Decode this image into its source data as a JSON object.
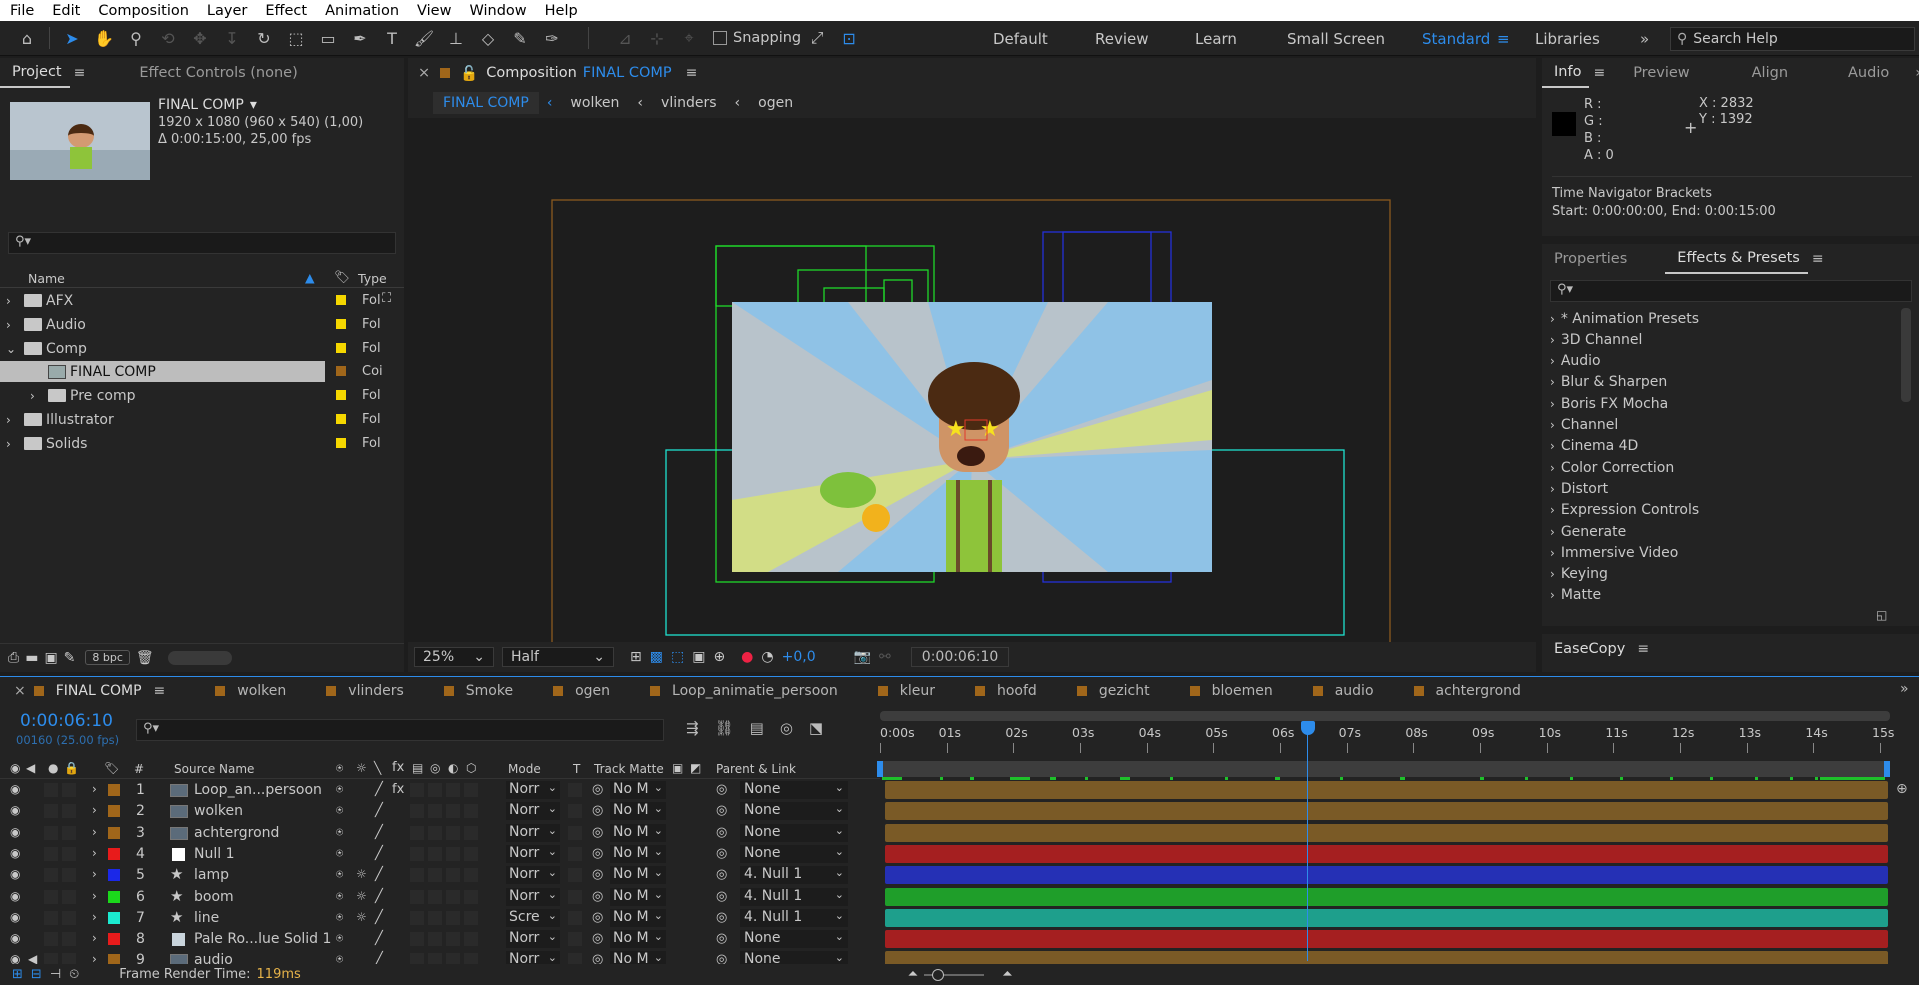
{
  "menu": [
    "File",
    "Edit",
    "Composition",
    "Layer",
    "Effect",
    "Animation",
    "View",
    "Window",
    "Help"
  ],
  "toolbar": {
    "snapping": "Snapping"
  },
  "workspaces": [
    "Default",
    "Review",
    "Learn",
    "Small Screen",
    "Standard",
    "Libraries"
  ],
  "active_workspace": "Standard",
  "search": {
    "placeholder": "Search Help"
  },
  "project": {
    "tabs": [
      "Project",
      "Effect Controls (none)"
    ],
    "comp_name": "FINAL COMP",
    "comp_info1": "1920 x 1080  (960 x 540) (1,00)",
    "comp_info2": "Δ 0:00:15:00, 25,00 fps",
    "columns": {
      "name": "Name",
      "type": "Type"
    },
    "items": [
      {
        "name": "AFX",
        "type": "Fol",
        "color": "#f5d700"
      },
      {
        "name": "Audio",
        "type": "Fol",
        "color": "#f5d700"
      },
      {
        "name": "Comp",
        "type": "Fol",
        "color": "#f5d700"
      },
      {
        "name": "FINAL COMP",
        "type": "Coi",
        "color": "#a0661a"
      },
      {
        "name": "Pre comp",
        "type": "Fol",
        "color": "#f5d700"
      },
      {
        "name": "Illustrator",
        "type": "Fol",
        "color": "#f5d700"
      },
      {
        "name": "Solids",
        "type": "Fol",
        "color": "#f5d700"
      }
    ],
    "bpc": "8 bpc"
  },
  "comp": {
    "tab_prefix": "Composition",
    "tab_name": "FINAL COMP",
    "breadcrumbs": [
      "FINAL COMP",
      "wolken",
      "vlinders",
      "ogen"
    ],
    "zoom": "25%",
    "resolution": "Half",
    "exposure": "+0,0",
    "timecode": "0:00:06:10"
  },
  "info": {
    "tabs": [
      "Info",
      "Preview",
      "Align",
      "Audio"
    ],
    "r": "R :",
    "g": "G :",
    "b": "B :",
    "a": "A :  0",
    "x": "X : 2832",
    "y": "Y : 1392",
    "line1": "Time Navigator Brackets",
    "line2": "Start: 0:00:00:00, End: 0:00:15:00"
  },
  "effects": {
    "tabs": [
      "Properties",
      "Effects & Presets"
    ],
    "items": [
      "* Animation Presets",
      "3D Channel",
      "Audio",
      "Blur & Sharpen",
      "Boris FX Mocha",
      "Channel",
      "Cinema 4D",
      "Color Correction",
      "Distort",
      "Expression Controls",
      "Generate",
      "Immersive Video",
      "Keying",
      "Matte"
    ]
  },
  "easecopy": {
    "title": "EaseCopy"
  },
  "timeline": {
    "tabs": [
      {
        "name": "FINAL COMP",
        "color": "#a0661a"
      },
      {
        "name": "wolken",
        "color": "#a0661a"
      },
      {
        "name": "vlinders",
        "color": "#a0661a"
      },
      {
        "name": "Smoke",
        "color": "#a0661a"
      },
      {
        "name": "ogen",
        "color": "#a0661a"
      },
      {
        "name": "Loop_animatie_persoon",
        "color": "#a0661a"
      },
      {
        "name": "kleur",
        "color": "#a0661a"
      },
      {
        "name": "hoofd",
        "color": "#a0661a"
      },
      {
        "name": "gezicht",
        "color": "#a0661a"
      },
      {
        "name": "bloemen",
        "color": "#a0661a"
      },
      {
        "name": "audio",
        "color": "#a0661a"
      },
      {
        "name": "achtergrond",
        "color": "#a0661a"
      }
    ],
    "timecode": "0:00:06:10",
    "frames": "00160 (25.00 fps)",
    "headers": {
      "num": "#",
      "source": "Source Name",
      "mode": "Mode",
      "t": "T",
      "matte": "Track Matte",
      "parent": "Parent & Link"
    },
    "ruler": [
      "0:00s",
      "01s",
      "02s",
      "03s",
      "04s",
      "05s",
      "06s",
      "07s",
      "08s",
      "09s",
      "10s",
      "11s",
      "12s",
      "13s",
      "14s",
      "15s"
    ],
    "layers": [
      {
        "num": "1",
        "name": "Loop_an...persoon",
        "mode": "Norr",
        "matte": "No M",
        "parent": "None",
        "label": "#a0661a",
        "icon": "comp",
        "bar": "#7a5a26"
      },
      {
        "num": "2",
        "name": "wolken",
        "mode": "Norr",
        "matte": "No M",
        "parent": "None",
        "label": "#a0661a",
        "icon": "comp",
        "bar": "#7a5a26"
      },
      {
        "num": "3",
        "name": "achtergrond",
        "mode": "Norr",
        "matte": "No M",
        "parent": "None",
        "label": "#a0661a",
        "icon": "comp",
        "bar": "#7a5a26"
      },
      {
        "num": "4",
        "name": "Null 1",
        "mode": "Norr",
        "matte": "No M",
        "parent": "None",
        "label": "#e81b1b",
        "icon": "null",
        "bar": "#a51f20"
      },
      {
        "num": "5",
        "name": "lamp",
        "mode": "Norr",
        "matte": "No M",
        "parent": "4. Null 1",
        "label": "#1b28e8",
        "icon": "star",
        "bar": "#2530b5"
      },
      {
        "num": "6",
        "name": "boom",
        "mode": "Norr",
        "matte": "No M",
        "parent": "4. Null 1",
        "label": "#1bd81b",
        "icon": "star",
        "bar": "#1f9e2a"
      },
      {
        "num": "7",
        "name": "line",
        "mode": "Scre",
        "matte": "No M",
        "parent": "4. Null 1",
        "label": "#1bead0",
        "icon": "star",
        "bar": "#1e9f8c"
      },
      {
        "num": "8",
        "name": "Pale Ro...lue Solid 1",
        "mode": "Norr",
        "matte": "No M",
        "parent": "None",
        "label": "#e81b1b",
        "icon": "solid",
        "bar": "#a51f20"
      },
      {
        "num": "9",
        "name": "audio",
        "mode": "Norr",
        "matte": "No M",
        "parent": "None",
        "label": "#a0661a",
        "icon": "comp",
        "bar": "#7a5a26"
      }
    ],
    "render_label": "Frame Render Time:",
    "render_value": "119ms"
  }
}
